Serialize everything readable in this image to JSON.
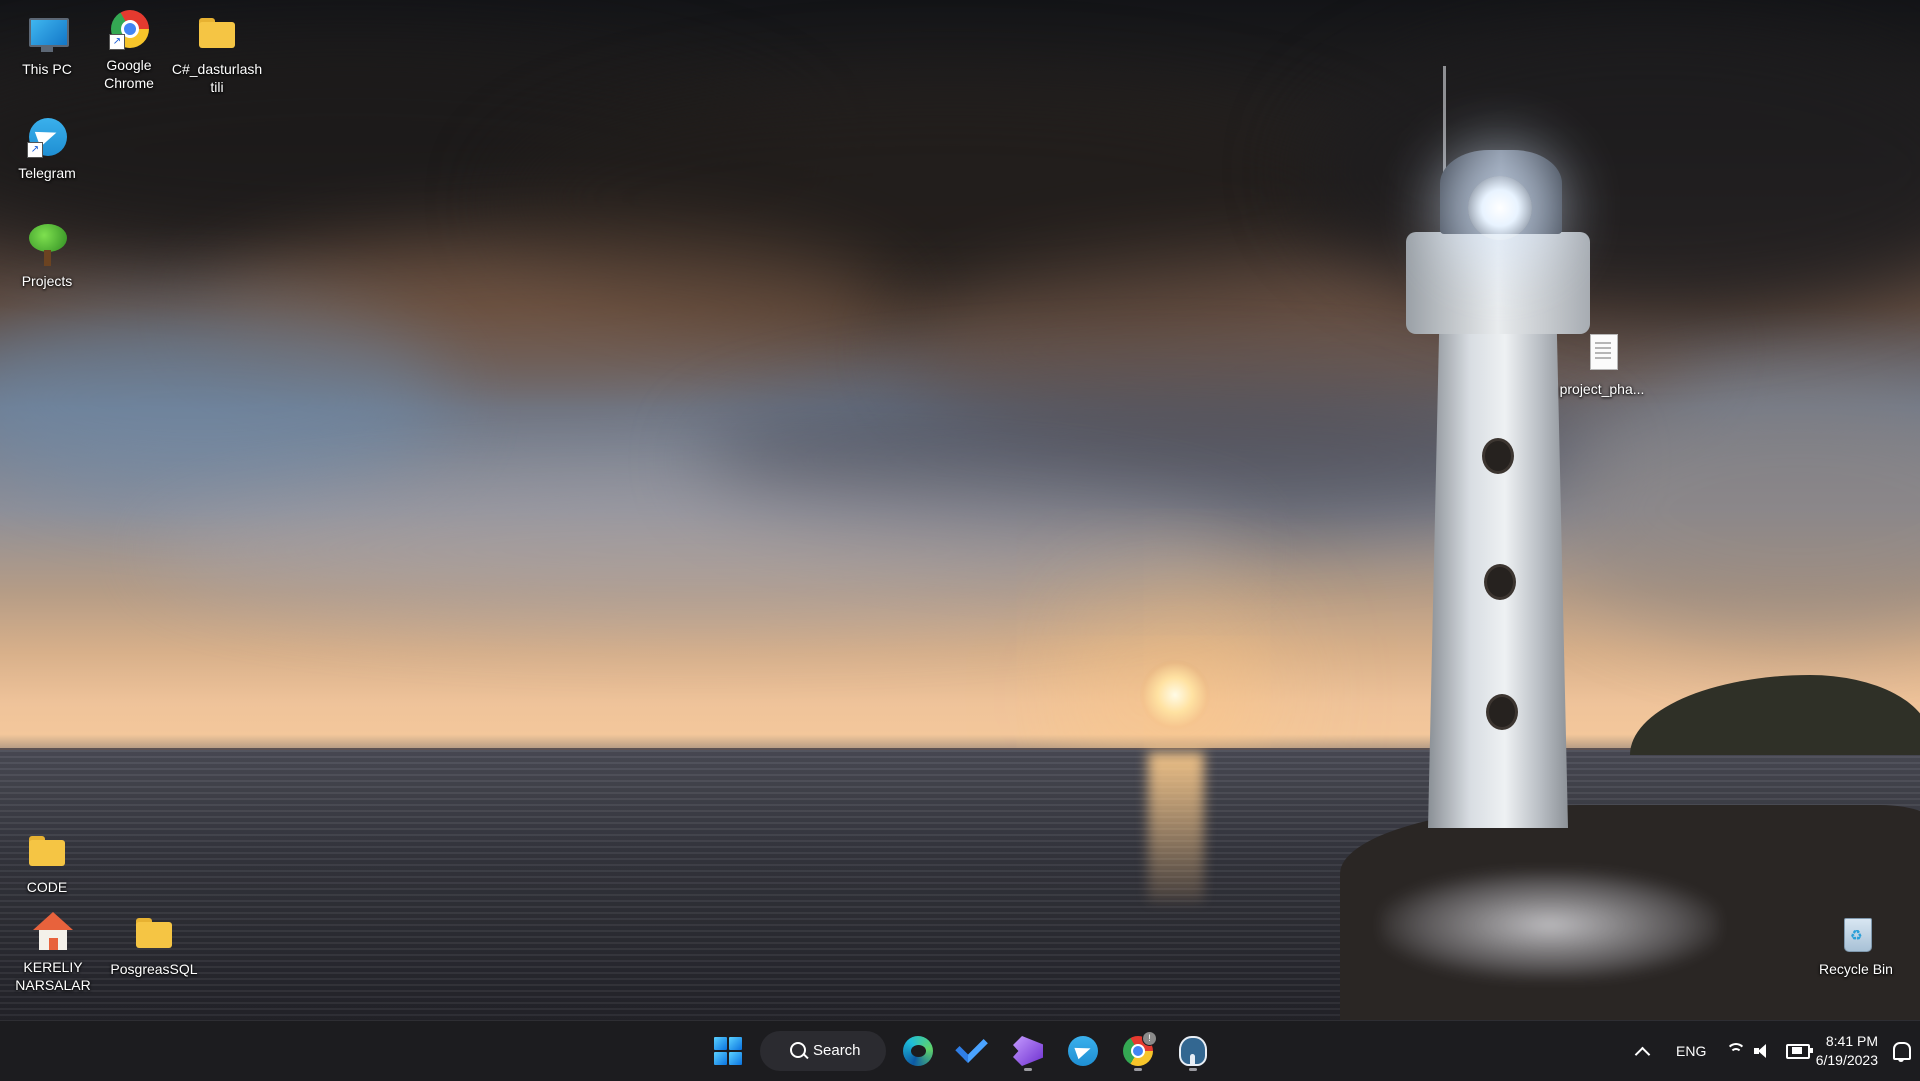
{
  "desktop": {
    "icons": [
      {
        "label": "This PC",
        "icon": "monitor-icon"
      },
      {
        "label": "Google\nChrome",
        "icon": "chrome-icon"
      },
      {
        "label": "C#_dasturlash\ntili",
        "icon": "folder-icon"
      },
      {
        "label": "Telegram",
        "icon": "telegram-icon"
      },
      {
        "label": "Projects",
        "icon": "tree-icon"
      },
      {
        "label": "project_pha...",
        "icon": "text-document-icon"
      },
      {
        "label": "CODE",
        "icon": "folder-icon"
      },
      {
        "label": "KERELIY\nNARSALAR",
        "icon": "home-icon"
      },
      {
        "label": "PosgreasSQL",
        "icon": "folder-icon"
      },
      {
        "label": "Recycle Bin",
        "icon": "recycle-bin-icon"
      }
    ]
  },
  "taskbar": {
    "search_label": "Search",
    "apps": [
      {
        "name": "Start",
        "icon": "windows-logo-icon"
      },
      {
        "name": "Microsoft Edge",
        "icon": "edge-icon"
      },
      {
        "name": "Microsoft To Do",
        "icon": "todo-icon"
      },
      {
        "name": "Visual Studio",
        "icon": "visual-studio-icon"
      },
      {
        "name": "Telegram",
        "icon": "telegram-icon"
      },
      {
        "name": "Google Chrome",
        "icon": "chrome-icon"
      },
      {
        "name": "PostgreSQL",
        "icon": "postgresql-icon"
      }
    ],
    "tray": {
      "language": "ENG",
      "time": "8:41 PM",
      "date": "6/19/2023"
    }
  },
  "colors": {
    "taskbar_bg": "#1c1c1f",
    "folder": "#f5c544",
    "accent": "#0a73e0"
  }
}
